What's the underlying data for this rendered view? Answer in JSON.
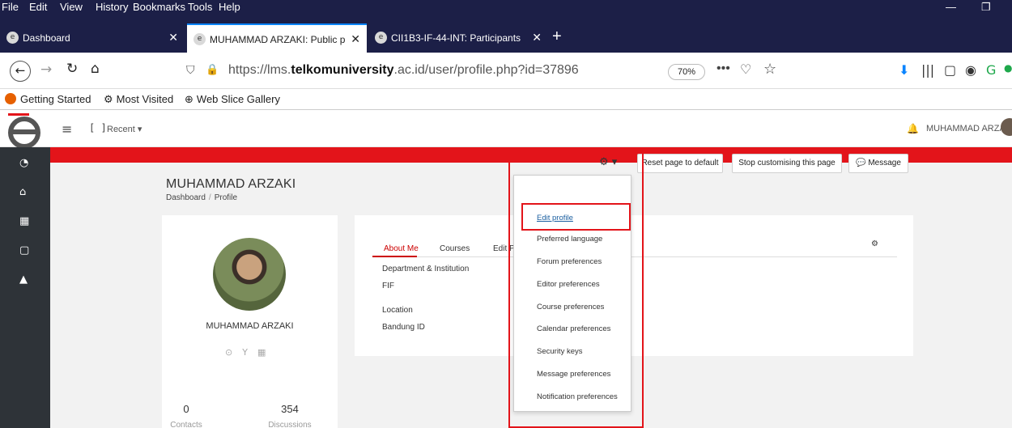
{
  "menubar": {
    "items": [
      "File",
      "Edit",
      "View",
      "History",
      "Bookmarks",
      "Tools",
      "Help"
    ]
  },
  "tabs": [
    {
      "title": "Dashboard",
      "active": false
    },
    {
      "title": "MUHAMMAD ARZAKI: Public p",
      "active": true
    },
    {
      "title": "CII1B3-IF-44-INT: Participants",
      "active": false
    }
  ],
  "urlbar": {
    "url_prefix": "https://lms.",
    "url_domain": "telkomuniversity",
    "url_suffix": ".ac.id/user/profile.php?id=37896",
    "zoom": "70%"
  },
  "bookmarks": [
    "Getting Started",
    "Most Visited",
    "Web Slice Gallery"
  ],
  "header": {
    "recent": "Recent ▾",
    "user_name": "MUHAMMAD ARZAKI"
  },
  "page": {
    "title": "MUHAMMAD ARZAKI",
    "breadcrumb": [
      "Dashboard",
      "Profile"
    ],
    "buttons": {
      "reset": "Reset page to default",
      "stop": "Stop customising this page",
      "message": "Message"
    }
  },
  "profile_card": {
    "name": "MUHAMMAD ARZAKI",
    "contacts_count": "0",
    "contacts_label": "Contacts",
    "discussions_count": "354",
    "discussions_label": "Discussions"
  },
  "profile_tabs": [
    "About Me",
    "Courses",
    "Edit P"
  ],
  "fields": {
    "dept_label": "Department & Institution",
    "dept_value": "FIF",
    "location_label": "Location",
    "location_value": "Bandung ID"
  },
  "dropdown": [
    "Edit profile",
    "Preferred language",
    "Forum preferences",
    "Editor preferences",
    "Course preferences",
    "Calendar preferences",
    "Security keys",
    "Message preferences",
    "Notification preferences"
  ],
  "colors": {
    "accent_red": "#e3141a",
    "chrome": "#1c1f47",
    "sidebar": "#2e3338"
  }
}
